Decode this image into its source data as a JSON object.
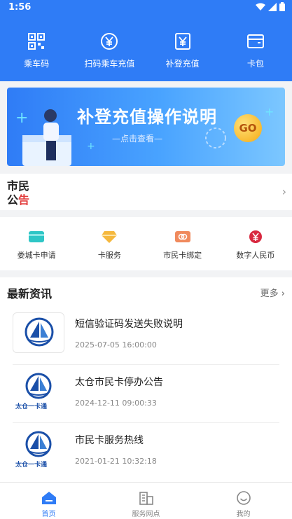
{
  "status_bar": {
    "time": "1:56"
  },
  "top_nav": [
    {
      "label": "乘车码",
      "icon": "qr-code-icon"
    },
    {
      "label": "扫码乘车充值",
      "icon": "yuan-circle-icon"
    },
    {
      "label": "补登充值",
      "icon": "yuan-card-icon"
    },
    {
      "label": "卡包",
      "icon": "wallet-icon"
    }
  ],
  "banner": {
    "title": "补登充值操作说明",
    "subtitle": "—点击查看—",
    "go": "GO"
  },
  "notice": {
    "label_1": "市民",
    "label_2a": "公",
    "label_2b": "告"
  },
  "services": [
    {
      "label": "娄城卡申请",
      "icon": "card-icon",
      "color": "#2ec6c6"
    },
    {
      "label": "卡服务",
      "icon": "diamond-icon",
      "color": "#f5b83d"
    },
    {
      "label": "市民卡绑定",
      "icon": "link-card-icon",
      "color": "#f08a5d"
    },
    {
      "label": "数字人民币",
      "icon": "yuan-coin-icon",
      "color": "#d8283f"
    }
  ],
  "news": {
    "header": "最新资讯",
    "more": "更多",
    "items": [
      {
        "title": "短信验证码发送失败说明",
        "date": "2025-07-05 16:00:00",
        "caption": ""
      },
      {
        "title": "太仓市民卡停办公告",
        "date": "2024-12-11 09:00:33",
        "caption": "太仓一卡通"
      },
      {
        "title": "市民卡服务热线",
        "date": "2021-01-21 10:32:18",
        "caption": "太仓一卡通"
      }
    ]
  },
  "bottom_nav": [
    {
      "label": "首页",
      "icon": "home-icon",
      "active": true
    },
    {
      "label": "服务网点",
      "icon": "building-icon",
      "active": false
    },
    {
      "label": "我的",
      "icon": "smiley-icon",
      "active": false
    }
  ],
  "colors": {
    "primary": "#2f7cf6",
    "accent_red": "#e23b3b"
  }
}
